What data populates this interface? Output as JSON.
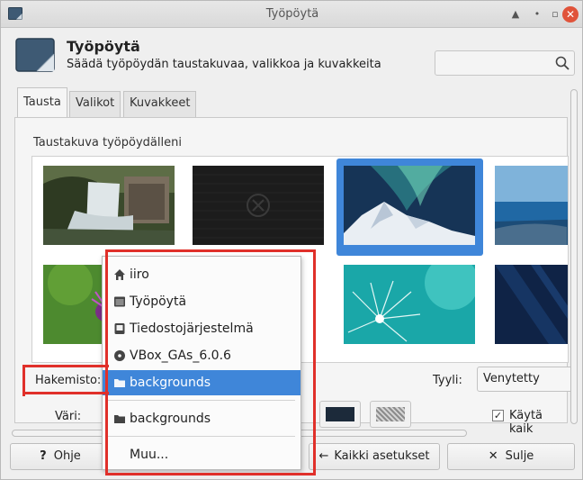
{
  "window": {
    "title": "Työpöytä",
    "header_title": "Työpöytä",
    "header_subtitle": "Säädä työpöydän taustakuvaa, valikkoa ja kuvakkeita",
    "search_placeholder": ""
  },
  "tabs": [
    {
      "label": "Tausta",
      "active": true
    },
    {
      "label": "Valikot",
      "active": false
    },
    {
      "label": "Kuvakkeet",
      "active": false
    }
  ],
  "background_tab": {
    "section_label": "Taustakuva työpöydälleni",
    "thumbnails": [
      {
        "name": "waterfall-mill",
        "selected": false
      },
      {
        "name": "dark-xfce-logo",
        "selected": false
      },
      {
        "name": "aurora-mountain",
        "selected": true
      },
      {
        "name": "blue-seashore",
        "selected": false
      },
      {
        "name": "purple-thistle",
        "selected": false
      },
      {
        "name": "hidden-under-menu",
        "selected": false
      },
      {
        "name": "dewdrops-teal",
        "selected": false
      },
      {
        "name": "dark-blue-geometric",
        "selected": false
      }
    ],
    "directory_label": "Hakemisto:",
    "style_label": "Tyyli:",
    "style_value": "Venytetty",
    "color_label": "Väri:",
    "apply_all_label": "Käytä kaik",
    "apply_all_checked": true
  },
  "buttons": {
    "help": "Ohje",
    "all_settings": "Kaikki asetukset",
    "close": "Sulje"
  },
  "directory_menu": {
    "items": [
      {
        "label": "iiro",
        "icon": "home-icon",
        "selected": false
      },
      {
        "label": "Työpöytä",
        "icon": "desktop-icon",
        "selected": false
      },
      {
        "label": "Tiedostojärjestelmä",
        "icon": "drive-icon",
        "selected": false
      },
      {
        "label": "VBox_GAs_6.0.6",
        "icon": "disc-icon",
        "selected": false
      },
      {
        "label": "backgrounds",
        "icon": "folder-icon",
        "selected": true
      }
    ],
    "recent_item": {
      "label": "backgrounds",
      "icon": "folder-icon"
    },
    "other_item": "Muu..."
  },
  "colors": {
    "accent": "#3f86d9",
    "annotation": "#e0302a"
  }
}
